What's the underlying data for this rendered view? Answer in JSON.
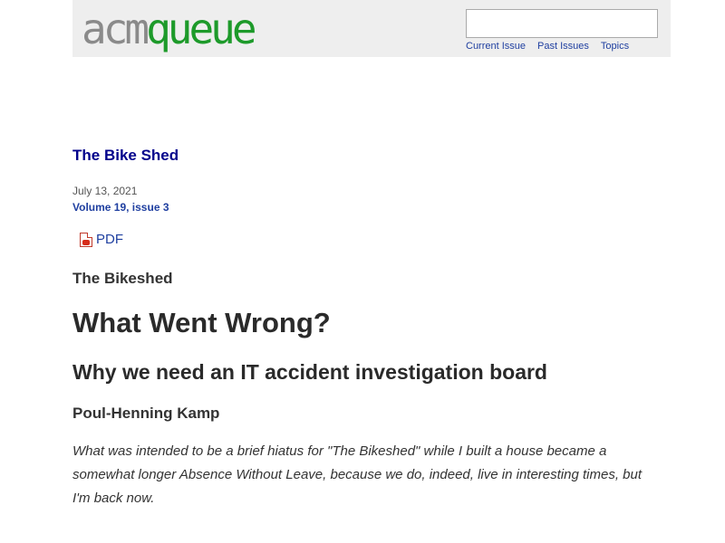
{
  "header": {
    "logo": {
      "part1": "acm",
      "part2": "queue"
    },
    "search": {
      "value": "",
      "placeholder": ""
    },
    "nav": [
      {
        "label": "Current Issue"
      },
      {
        "label": "Past Issues"
      },
      {
        "label": "Topics"
      }
    ]
  },
  "article": {
    "column_title": "The Bike Shed",
    "date": "July 13, 2021",
    "volume": "Volume 19, issue 3",
    "pdf_label": "PDF",
    "section": "The Bikeshed",
    "headline": "What Went Wrong?",
    "subhead": "Why we need an IT accident investigation board",
    "author": "Poul-Henning Kamp",
    "lede": "What was intended to be a brief hiatus for \"The Bikeshed\" while I built a house became a somewhat longer Absence Without Leave, because we do, indeed, live in interesting times, but I'm back now."
  },
  "colors": {
    "logo_gray": "#8a8a8a",
    "logo_green": "#1d9a2a",
    "link_blue": "#1f3fa0",
    "column_title": "#00008b",
    "header_bg": "#eeeeee"
  },
  "icons": {
    "pdf": "pdf-file-icon"
  }
}
